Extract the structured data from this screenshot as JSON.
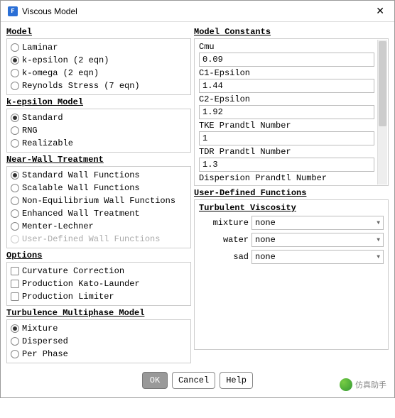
{
  "window": {
    "title": "Viscous Model"
  },
  "sections": {
    "model": {
      "title": "Model",
      "items": [
        "Laminar",
        "k-epsilon (2 eqn)",
        "k-omega (2 eqn)",
        "Reynolds Stress (7 eqn)"
      ],
      "selected": 1
    },
    "keps": {
      "title": "k-epsilon Model",
      "items": [
        "Standard",
        "RNG",
        "Realizable"
      ],
      "selected": 0
    },
    "nwt": {
      "title": "Near-Wall Treatment",
      "items": [
        "Standard Wall Functions",
        "Scalable Wall Functions",
        "Non-Equilibrium Wall Functions",
        "Enhanced Wall Treatment",
        "Menter-Lechner",
        "User-Defined Wall Functions"
      ],
      "selected": 0,
      "disabledIndex": 5
    },
    "options": {
      "title": "Options",
      "items": [
        "Curvature Correction",
        "Production Kato-Launder",
        "Production Limiter"
      ]
    },
    "tmm": {
      "title": "Turbulence Multiphase Model",
      "items": [
        "Mixture",
        "Dispersed",
        "Per Phase"
      ],
      "selected": 0
    }
  },
  "constants": {
    "title": "Model Constants",
    "items": [
      {
        "label": "Cmu",
        "value": "0.09"
      },
      {
        "label": "C1-Epsilon",
        "value": "1.44"
      },
      {
        "label": "C2-Epsilon",
        "value": "1.92"
      },
      {
        "label": "TKE Prandtl Number",
        "value": "1"
      },
      {
        "label": "TDR Prandtl Number",
        "value": "1.3"
      }
    ],
    "cutoffLabel": "Dispersion Prandtl Number"
  },
  "udf": {
    "title": "User-Defined Functions",
    "subtitle": "Turbulent Viscosity",
    "rows": [
      {
        "label": "mixture",
        "value": "none"
      },
      {
        "label": "water",
        "value": "none"
      },
      {
        "label": "sad",
        "value": "none"
      }
    ]
  },
  "buttons": {
    "ok": "OK",
    "cancel": "Cancel",
    "help": "Help"
  },
  "watermark": "仿真助手"
}
